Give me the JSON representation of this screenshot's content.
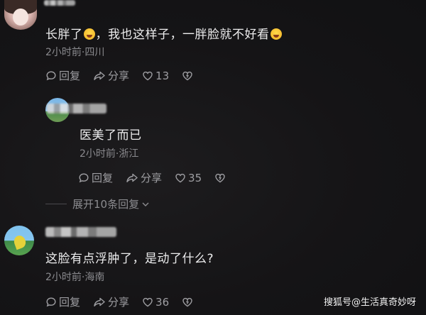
{
  "comments": [
    {
      "text_a": "长胖了",
      "text_b": "，我也这样子，一胖脸就不好看",
      "meta": "2小时前·四川",
      "reply_label": "回复",
      "share_label": "分享",
      "like_count": "13"
    },
    {
      "text": "医美了而已",
      "meta": "2小时前·浙江",
      "reply_label": "回复",
      "share_label": "分享",
      "like_count": "35"
    },
    {
      "text": "这脸有点浮肿了，是动了什么?",
      "meta": "2小时前·海南",
      "reply_label": "回复",
      "share_label": "分享",
      "like_count": "36"
    }
  ],
  "expand_replies": "展开10条回复",
  "watermark": "搜狐号@生活真奇妙呀",
  "icons": [
    "comment-icon",
    "share-icon",
    "heart-icon",
    "dislike-icon",
    "chevron-down-icon",
    "laughing-emoji-icon"
  ]
}
